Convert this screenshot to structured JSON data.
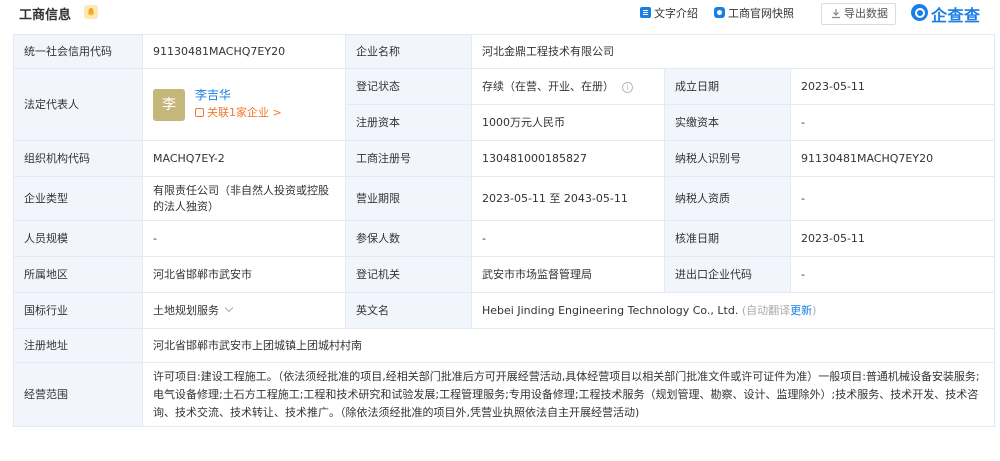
{
  "header": {
    "title": "工商信息",
    "text_intro": "文字介绍",
    "snapshot": "工商官网快照",
    "export": "导出数据",
    "logo": "企查查"
  },
  "rows": {
    "credit_code": {
      "label": "统一社会信用代码",
      "value": "91130481MACHQ7EY20"
    },
    "company_name": {
      "label": "企业名称",
      "value": "河北金鼎工程技术有限公司"
    },
    "legal_rep": {
      "label": "法定代表人",
      "avatar": "李",
      "name": "李吉华",
      "relation": "关联1家企业 >"
    },
    "reg_status": {
      "label": "登记状态",
      "value": "存续（在营、开业、在册）"
    },
    "established": {
      "label": "成立日期",
      "value": "2023-05-11"
    },
    "reg_capital": {
      "label": "注册资本",
      "value": "1000万元人民币"
    },
    "paid_capital": {
      "label": "实缴资本",
      "value": "-"
    },
    "org_code": {
      "label": "组织机构代码",
      "value": "MACHQ7EY-2"
    },
    "reg_number": {
      "label": "工商注册号",
      "value": "130481000185827"
    },
    "taxpayer_id": {
      "label": "纳税人识别号",
      "value": "91130481MACHQ7EY20"
    },
    "company_type": {
      "label": "企业类型",
      "value": "有限责任公司（非自然人投资或控股的法人独资）"
    },
    "term": {
      "label": "营业期限",
      "value": "2023-05-11 至 2043-05-11"
    },
    "taxpayer_qual": {
      "label": "纳税人资质",
      "value": "-"
    },
    "staff_size": {
      "label": "人员规模",
      "value": "-"
    },
    "insured": {
      "label": "参保人数",
      "value": "-"
    },
    "approval_date": {
      "label": "核准日期",
      "value": "2023-05-11"
    },
    "region": {
      "label": "所属地区",
      "value": "河北省邯郸市武安市"
    },
    "authority": {
      "label": "登记机关",
      "value": "武安市市场监督管理局"
    },
    "import_export": {
      "label": "进出口企业代码",
      "value": "-"
    },
    "industry": {
      "label": "国标行业",
      "value": "土地规划服务"
    },
    "english_name": {
      "label": "英文名",
      "value": "Hebei Jinding Engineering Technology Co., Ltd.",
      "note": "(自动翻译",
      "update": "更新",
      "note_close": ")"
    },
    "address": {
      "label": "注册地址",
      "value": "河北省邯郸市武安市上团城镇上团城村村南"
    },
    "scope": {
      "label": "经营范围",
      "value": "许可项目:建设工程施工。（依法须经批准的项目,经相关部门批准后方可开展经营活动,具体经营项目以相关部门批准文件或许可证件为准）一般项目:普通机械设备安装服务;电气设备修理;土石方工程施工;工程和技术研究和试验发展;工程管理服务;专用设备修理;工程技术服务（规划管理、勘察、设计、监理除外）;技术服务、技术开发、技术咨询、技术交流、技术转让、技术推广。（除依法须经批准的项目外,凭营业执照依法自主开展经营活动)"
    }
  }
}
